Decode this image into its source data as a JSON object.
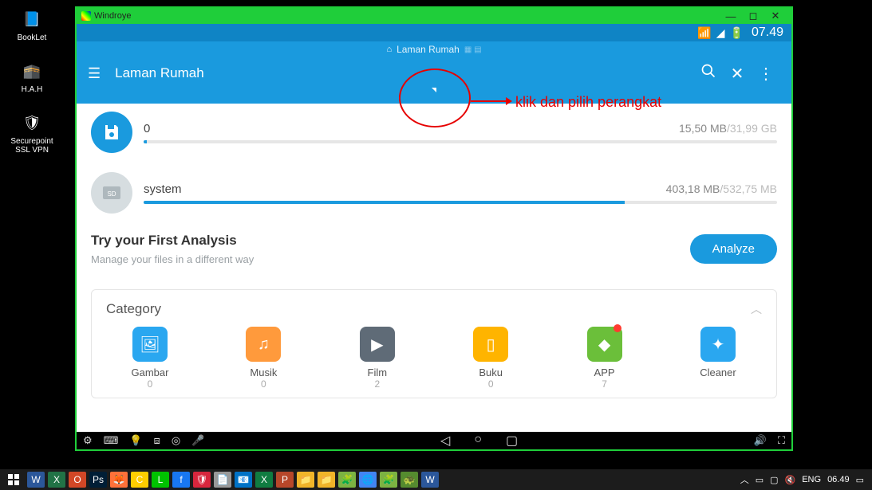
{
  "desktop": {
    "icons": [
      {
        "label": "BookLet",
        "symbol": "📘",
        "bg": "transparent"
      },
      {
        "label": "H.A.H",
        "symbol": "🕋",
        "bg": "transparent"
      },
      {
        "label": "Securepoint SSL VPN",
        "symbol": "🛡",
        "bg": "transparent"
      }
    ]
  },
  "emulator": {
    "title": "Windroye",
    "status": {
      "clock": "07.49"
    },
    "breadcrumb": {
      "label": "Laman Rumah"
    },
    "header": {
      "title": "Laman Rumah"
    },
    "storage": [
      {
        "label": "0",
        "used": "15,50 MB",
        "total": "31,99 GB",
        "fill_pct": 0.5,
        "icon": "disk",
        "icon_color": "blue"
      },
      {
        "label": "system",
        "used": "403,18 MB",
        "total": "532,75 MB",
        "fill_pct": 76,
        "icon": "sd",
        "icon_color": "grey"
      }
    ],
    "analysis": {
      "title": "Try your First Analysis",
      "subtitle": "Manage your files in a different way",
      "button": "Analyze"
    },
    "category": {
      "title": "Category",
      "items": [
        {
          "label": "Gambar",
          "count": "0",
          "color": "#2aa7f0",
          "symbol": "🖼"
        },
        {
          "label": "Musik",
          "count": "0",
          "color": "#ff9a3c",
          "symbol": "♫"
        },
        {
          "label": "Film",
          "count": "2",
          "color": "#5f6b77",
          "symbol": "▶"
        },
        {
          "label": "Buku",
          "count": "0",
          "color": "#ffb400",
          "symbol": "▯"
        },
        {
          "label": "APP",
          "count": "7",
          "color": "#6bbf3a",
          "symbol": "◆",
          "badge": true
        },
        {
          "label": "Cleaner",
          "count": "",
          "color": "#2aa7f0",
          "symbol": "✦"
        }
      ]
    }
  },
  "annotation": {
    "text": "klik dan pilih perangkat"
  },
  "taskbar": {
    "lang": "ENG",
    "clock": "06.49",
    "apps": [
      "W",
      "X",
      "O",
      "Ps",
      "🦊",
      "C",
      "L",
      "f",
      "🛡",
      "📄",
      "📧",
      "X",
      "P",
      "📁",
      "📁",
      "🧩",
      "🌐",
      "🧩",
      "🐢",
      "W"
    ]
  }
}
